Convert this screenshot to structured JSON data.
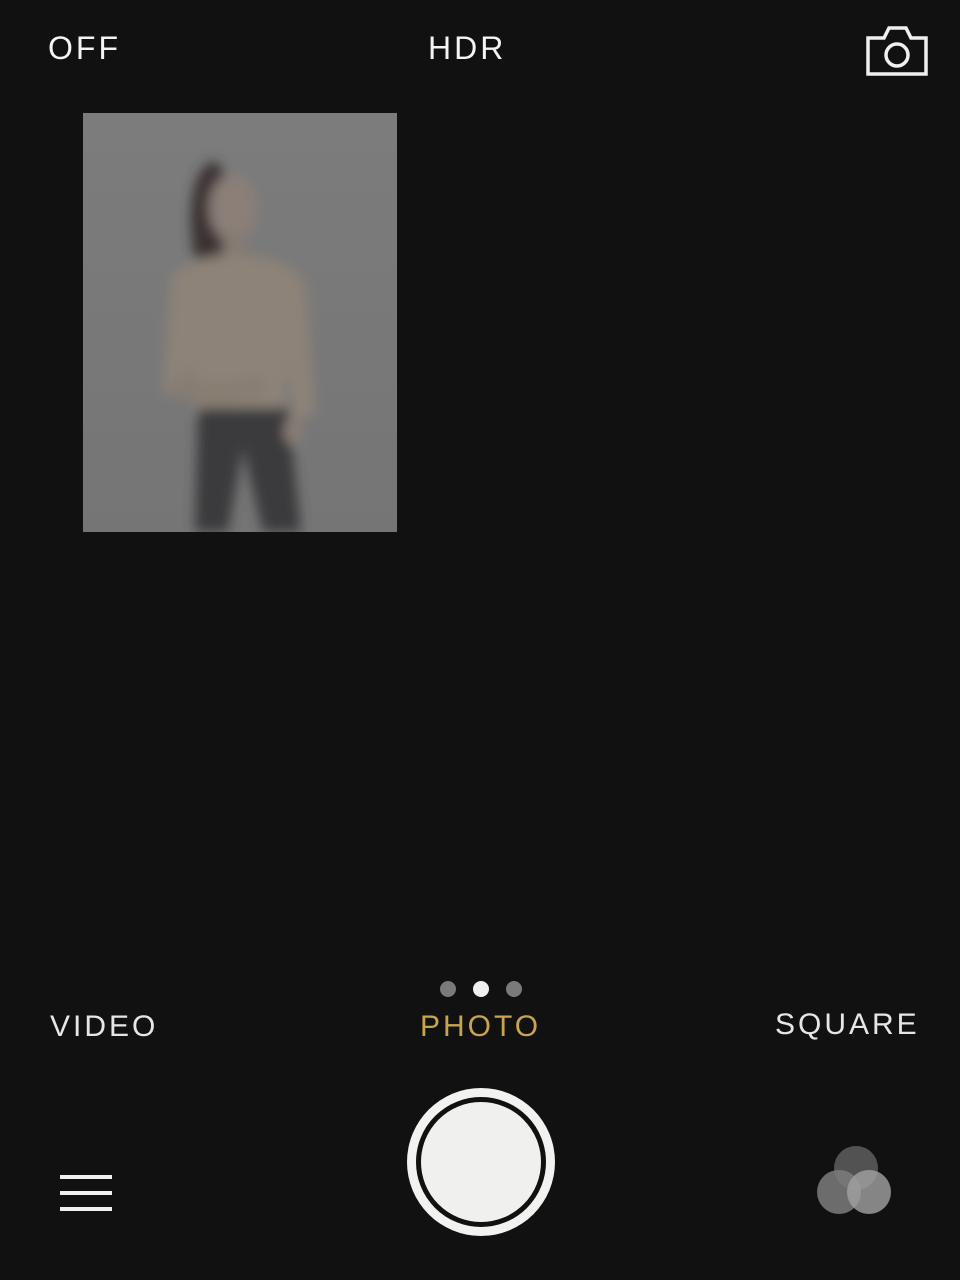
{
  "topbar": {
    "flash_label": "OFF",
    "hdr_label": "HDR",
    "switch_camera_icon": "camera-switch-icon"
  },
  "viewfinder": {
    "subject": "preview-image"
  },
  "modes": {
    "items": [
      "VIDEO",
      "PHOTO",
      "SQUARE"
    ],
    "video": "VIDEO",
    "photo": "PHOTO",
    "square": "SQUARE",
    "active": "PHOTO",
    "active_color": "#c9a44a"
  },
  "page_indicator": {
    "count": 3,
    "active_index": 1
  },
  "bottombar": {
    "menu_icon": "menu-icon",
    "shutter": "shutter-button",
    "filters_icon": "filters-icon"
  },
  "colors": {
    "background": "#111112",
    "text": "#f2f2f2",
    "accent": "#c9a44a"
  }
}
